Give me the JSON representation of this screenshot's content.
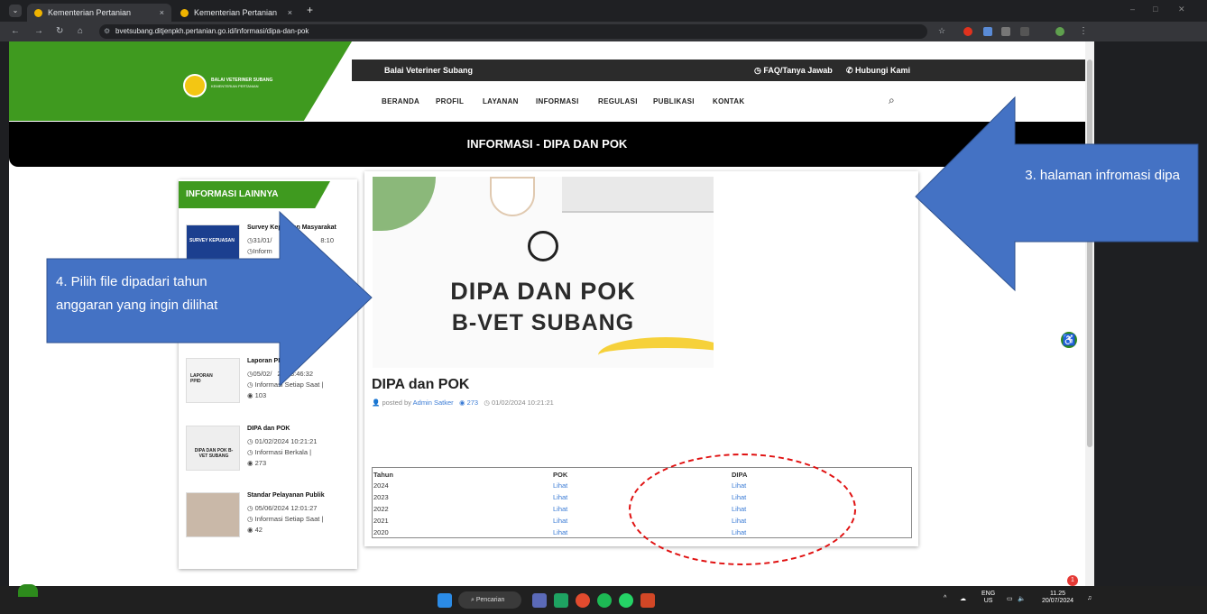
{
  "browser": {
    "tabs": [
      {
        "title": "Kementerian Pertanian",
        "close": "×"
      },
      {
        "title": "Kementerian Pertanian",
        "close": "×"
      }
    ],
    "new_tab": "+",
    "url": "bvetsubang.ditjenpkh.pertanian.go.id/informasi/dipa-dan-pok",
    "window_controls": [
      "–",
      "□",
      "✕"
    ]
  },
  "site": {
    "logo_title": "BALAI VETERINER SUBANG",
    "logo_subtitle": "KEMENTERIAN PERTANIAN",
    "top_title": "Balai Veteriner Subang",
    "top_links": {
      "faq": "FAQ/Tanya Jawab",
      "contact": "Hubungi Kami"
    },
    "nav": [
      "BERANDA",
      "PROFIL",
      "LAYANAN",
      "INFORMASI",
      "REGULASI",
      "PUBLIKASI",
      "KONTAK"
    ],
    "page_title": "INFORMASI - DIPA DAN POK"
  },
  "sidebar": {
    "heading": "INFORMASI LAINNYA",
    "posts": [
      {
        "title": "Survey Kepuasan Masyarakat",
        "thumb": "SURVEY KEPUASAN",
        "date": "31/01/",
        "time": "8:10",
        "category": "Inform",
        "views": ""
      },
      {
        "title": "Laporan PP",
        "thumb": "LAPORAN PPID",
        "date": "05/02/",
        "time": "24 13:46:32",
        "category": "Informasi Setiap Saat |",
        "views": "103"
      },
      {
        "title": "DIPA dan POK",
        "thumb": "DIPA DAN POK B-VET SUBANG",
        "date": "01/02/2024 10:21:21",
        "time": "",
        "category": "Informasi Berkala |",
        "views": "273"
      },
      {
        "title": "Standar Pelayanan Publik",
        "thumb": "",
        "date": "05/06/2024 12:01:27",
        "time": "",
        "category": "Informasi Setiap Saat |",
        "views": "42"
      }
    ]
  },
  "article": {
    "banner_line1": "DIPA DAN POK",
    "banner_line2": "B-VET SUBANG",
    "title": "DIPA dan POK",
    "posted_by": "posted by",
    "author": "Admin Satker",
    "views": "273",
    "datetime": "01/02/2024 10:21:21"
  },
  "table": {
    "headers": [
      "Tahun",
      "POK",
      "DIPA"
    ],
    "rows": [
      {
        "year": "2024",
        "pok": "Lihat",
        "dipa": "Lihat"
      },
      {
        "year": "2023",
        "pok": "Lihat",
        "dipa": "Lihat"
      },
      {
        "year": "2022",
        "pok": "Lihat",
        "dipa": "Lihat"
      },
      {
        "year": "2021",
        "pok": "Lihat",
        "dipa": "Lihat"
      },
      {
        "year": "2020",
        "pok": "Lihat",
        "dipa": "Lihat"
      }
    ]
  },
  "annotations": {
    "step3": "3. halaman infromasi dipa",
    "step4_line1": "4. Pilih file dipadari tahun",
    "step4_line2": "anggaran yang ingin dilihat"
  },
  "taskbar": {
    "search": "Pencarian",
    "lang_top": "ENG",
    "lang_bottom": "US",
    "time": "11.25",
    "date": "20/07/2024",
    "badge": "1"
  },
  "colors": {
    "green": "#3f9a1f",
    "arrow": "#4472c4",
    "link": "#3a7bd5",
    "dash": "#e01010"
  }
}
